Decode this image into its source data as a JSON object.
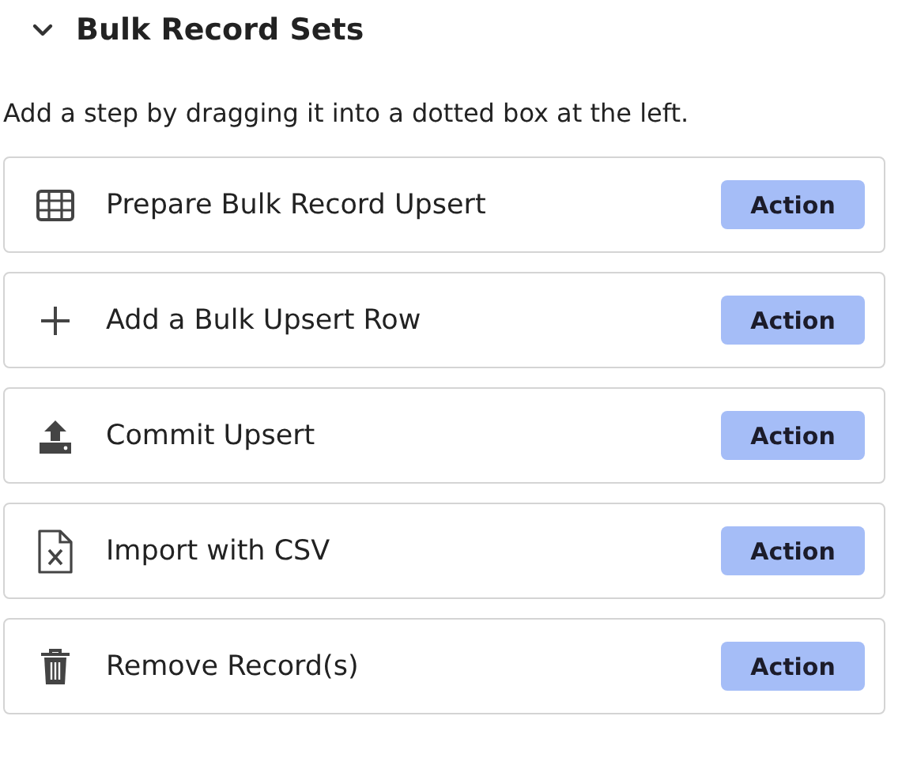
{
  "section": {
    "title": "Bulk Record Sets",
    "expanded": true
  },
  "hint": "Add a step by dragging it into a dotted box at the left.",
  "steps": [
    {
      "kind": "table",
      "label": "Prepare Bulk Record Upsert",
      "badge": "Action"
    },
    {
      "kind": "plus",
      "label": "Add a Bulk Upsert Row",
      "badge": "Action"
    },
    {
      "kind": "upload",
      "label": "Commit Upsert",
      "badge": "Action"
    },
    {
      "kind": "csv",
      "label": "Import with CSV",
      "badge": "Action"
    },
    {
      "kind": "trash",
      "label": "Remove Record(s)",
      "badge": "Action"
    }
  ]
}
